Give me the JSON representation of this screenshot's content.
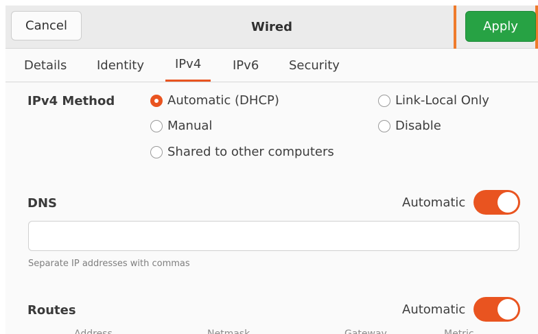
{
  "header": {
    "cancel_label": "Cancel",
    "title": "Wired",
    "apply_label": "Apply"
  },
  "tabs": [
    {
      "label": "Details"
    },
    {
      "label": "Identity"
    },
    {
      "label": "IPv4",
      "active": true
    },
    {
      "label": "IPv6"
    },
    {
      "label": "Security"
    }
  ],
  "ipv4_method": {
    "label": "IPv4 Method",
    "options": [
      {
        "label": "Automatic (DHCP)",
        "selected": true
      },
      {
        "label": "Link-Local Only",
        "selected": false
      },
      {
        "label": "Manual",
        "selected": false
      },
      {
        "label": "Disable",
        "selected": false
      },
      {
        "label": "Shared to other computers",
        "selected": false
      }
    ]
  },
  "dns": {
    "label": "DNS",
    "automatic_label": "Automatic",
    "automatic_on": true,
    "value": "",
    "hint": "Separate IP addresses with commas"
  },
  "routes": {
    "label": "Routes",
    "automatic_label": "Automatic",
    "automatic_on": true,
    "columns": [
      "Address",
      "Netmask",
      "Gateway",
      "Metric"
    ]
  },
  "colors": {
    "accent": "#e95420",
    "apply_green": "#27a244",
    "highlight_orange": "#ef7b2b"
  }
}
